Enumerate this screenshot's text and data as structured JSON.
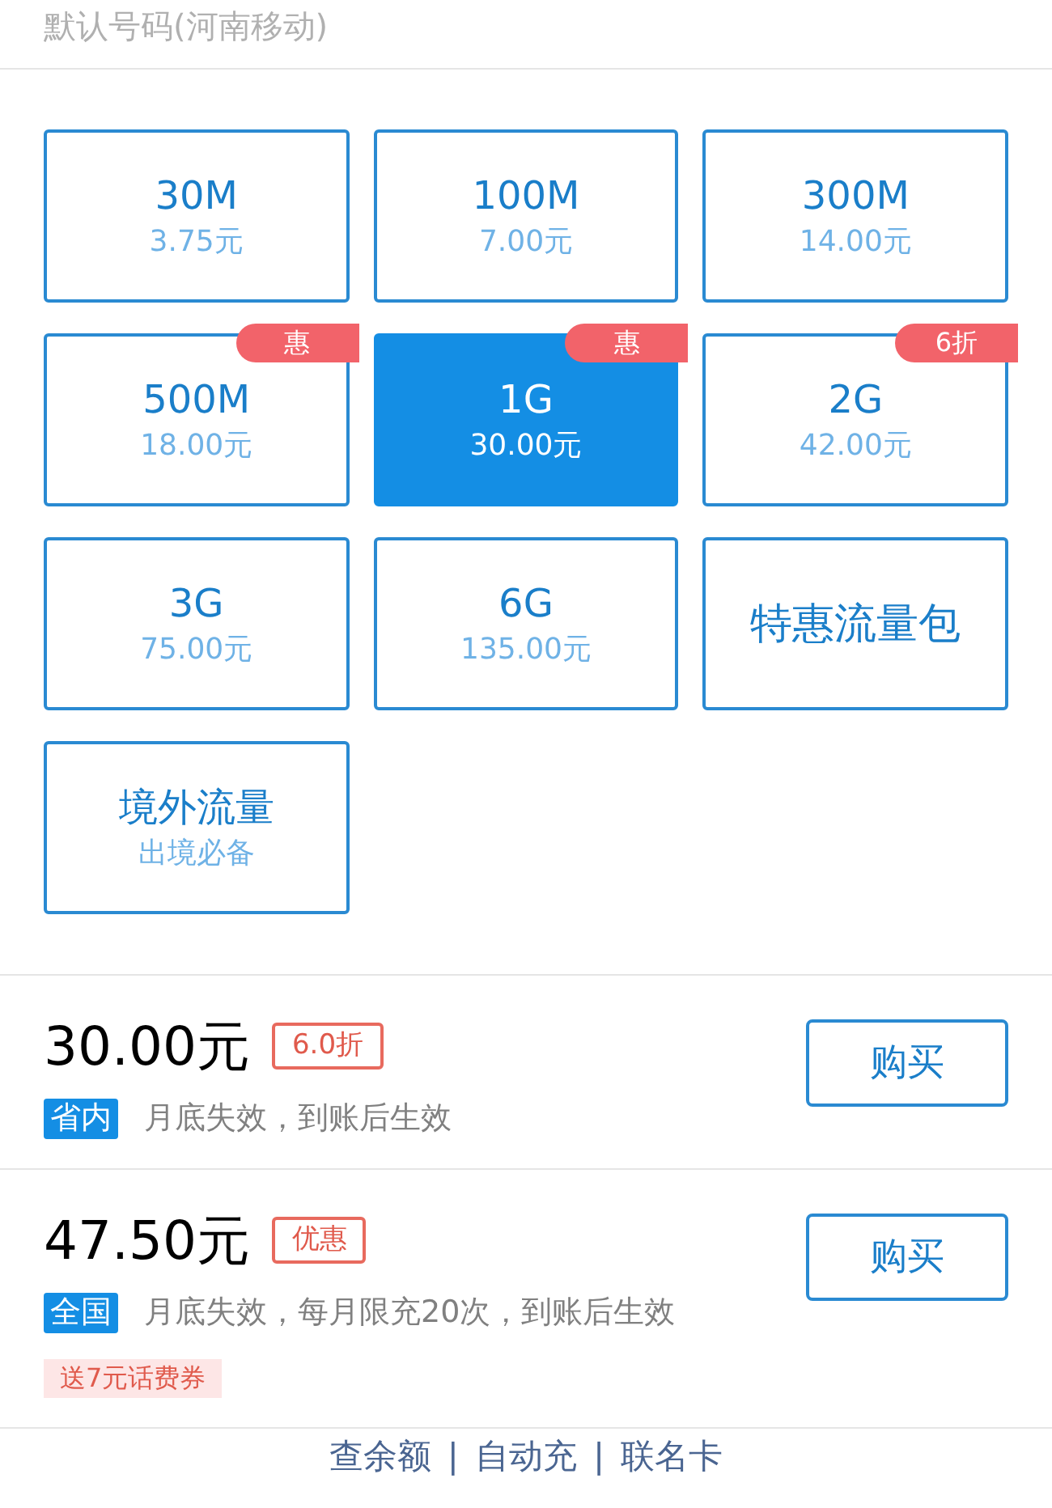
{
  "header": {
    "number_label": "默认号码(河南移动)"
  },
  "packages": [
    {
      "title": "30M",
      "subtitle": "3.75元",
      "selected": false
    },
    {
      "title": "100M",
      "subtitle": "7.00元",
      "selected": false
    },
    {
      "title": "300M",
      "subtitle": "14.00元",
      "selected": false
    },
    {
      "title": "500M",
      "subtitle": "18.00元",
      "selected": false,
      "badge": "惠"
    },
    {
      "title": "1G",
      "subtitle": "30.00元",
      "selected": true,
      "badge": "惠"
    },
    {
      "title": "2G",
      "subtitle": "42.00元",
      "selected": false,
      "badge": "6折"
    },
    {
      "title": "3G",
      "subtitle": "75.00元",
      "selected": false
    },
    {
      "title": "6G",
      "subtitle": "135.00元",
      "selected": false
    },
    {
      "title": "特惠流量包",
      "selected": false
    },
    {
      "title": "境外流量",
      "subtitle": "出境必备",
      "selected": false
    }
  ],
  "offers": [
    {
      "price": "30.00元",
      "tag": "6.0折",
      "scope": "省内",
      "note": "月底失效，到账后生效",
      "button": "购买"
    },
    {
      "price": "47.50元",
      "tag": "优惠",
      "scope": "全国",
      "note": "月底失效，每月限充20次，到账后生效",
      "button": "购买",
      "gift": "送7元话费券"
    }
  ],
  "footer": {
    "links": [
      "查余额",
      "自动充",
      "联名卡"
    ],
    "separator": "|"
  }
}
